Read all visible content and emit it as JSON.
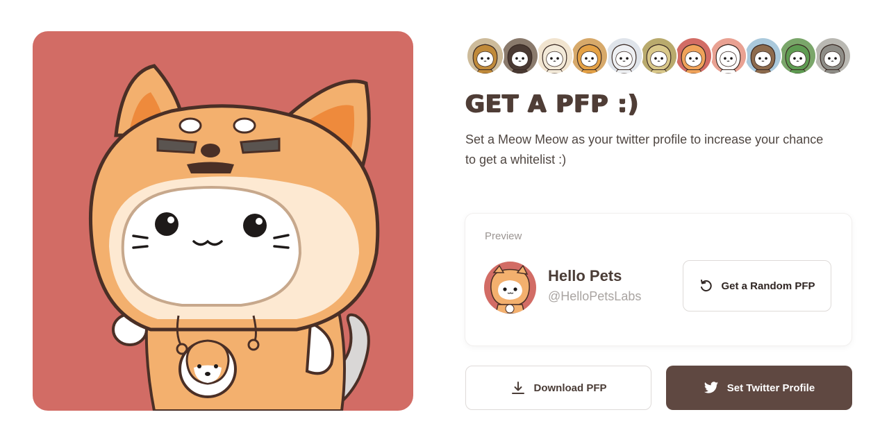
{
  "hero": {
    "title": "GET A PFP :)",
    "description": "Set a Meow Meow as your twitter profile to increase your chance to get a whitelist :)",
    "background_color": "#d26c65"
  },
  "avatar_strip": {
    "avatars": [
      {
        "name": "king-cat-avatar",
        "bg": "#cdbb9a",
        "hood": "#c08a3a"
      },
      {
        "name": "bearded-cat-avatar",
        "bg": "#8a7a6c",
        "hood": "#4a3a33"
      },
      {
        "name": "sheep-cat-avatar",
        "bg": "#f1e4cf",
        "hood": "#f3ead9"
      },
      {
        "name": "lion-cat-avatar",
        "bg": "#d7a96a",
        "hood": "#e4a145"
      },
      {
        "name": "angel-cat-avatar",
        "bg": "#dfe4ea",
        "hood": "#eef0f3"
      },
      {
        "name": "crown-cat-avatar",
        "bg": "#b9aa6d",
        "hood": "#d9c88a"
      },
      {
        "name": "shiba-cat-avatar",
        "bg": "#d26c65",
        "hood": "#f0a35a"
      },
      {
        "name": "chef-cat-avatar",
        "bg": "#e9a192",
        "hood": "#ffffff"
      },
      {
        "name": "pilot-cat-avatar",
        "bg": "#aac9dc",
        "hood": "#8d6b4d"
      },
      {
        "name": "frog-cat-avatar",
        "bg": "#7aa66a",
        "hood": "#5e9b52"
      },
      {
        "name": "totoro-cat-avatar",
        "bg": "#b9b8b2",
        "hood": "#8e8d87"
      }
    ]
  },
  "preview": {
    "label": "Preview",
    "name": "Hello Pets",
    "handle": "@HelloPetsLabs",
    "random_button": "Get a Random PFP"
  },
  "actions": {
    "download_button": "Download PFP",
    "twitter_button": "Set Twitter Profile"
  },
  "colors": {
    "brand_dark": "#5f4841",
    "text_dark": "#4a3c36",
    "muted": "#9b9592",
    "shiba_orange": "#f0a35a"
  }
}
